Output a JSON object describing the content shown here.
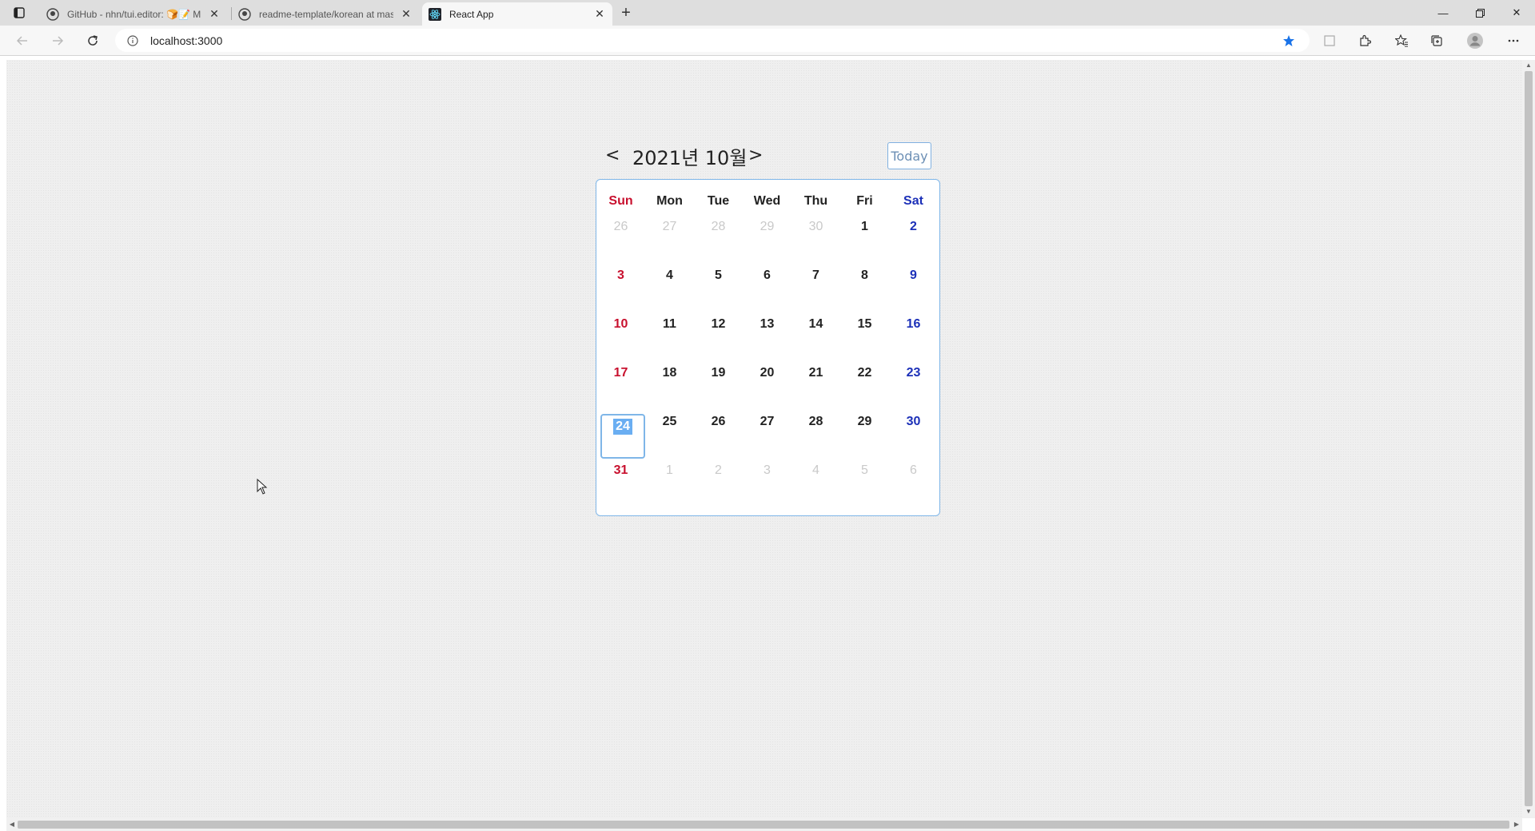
{
  "browser": {
    "tabs": [
      {
        "title": "GitHub - nhn/tui.editor: 🍞📝 M",
        "active": false,
        "icon": "github-icon"
      },
      {
        "title": "readme-template/korean at mas",
        "active": false,
        "icon": "github-icon"
      },
      {
        "title": "React App",
        "active": true,
        "icon": "react-icon"
      }
    ],
    "address": "localhost:3000"
  },
  "calendar": {
    "prev_label": "<",
    "next_label": ">",
    "title": "2021년 10월",
    "today_label": "Today",
    "weekdays": [
      "Sun",
      "Mon",
      "Tue",
      "Wed",
      "Thu",
      "Fri",
      "Sat"
    ],
    "weeks": [
      [
        "26",
        "27",
        "28",
        "29",
        "30",
        "1",
        "2"
      ],
      [
        "3",
        "4",
        "5",
        "6",
        "7",
        "8",
        "9"
      ],
      [
        "10",
        "11",
        "12",
        "13",
        "14",
        "15",
        "16"
      ],
      [
        "17",
        "18",
        "19",
        "20",
        "21",
        "22",
        "23"
      ],
      [
        "24",
        "25",
        "26",
        "27",
        "28",
        "29",
        "30"
      ],
      [
        "31",
        "1",
        "2",
        "3",
        "4",
        "5",
        "6"
      ]
    ],
    "selected_day": "24",
    "colors": {
      "sunday": "#c8102e",
      "saturday": "#1c30b8",
      "accent": "#7fb6e8",
      "muted": "#c9c9c9"
    }
  }
}
